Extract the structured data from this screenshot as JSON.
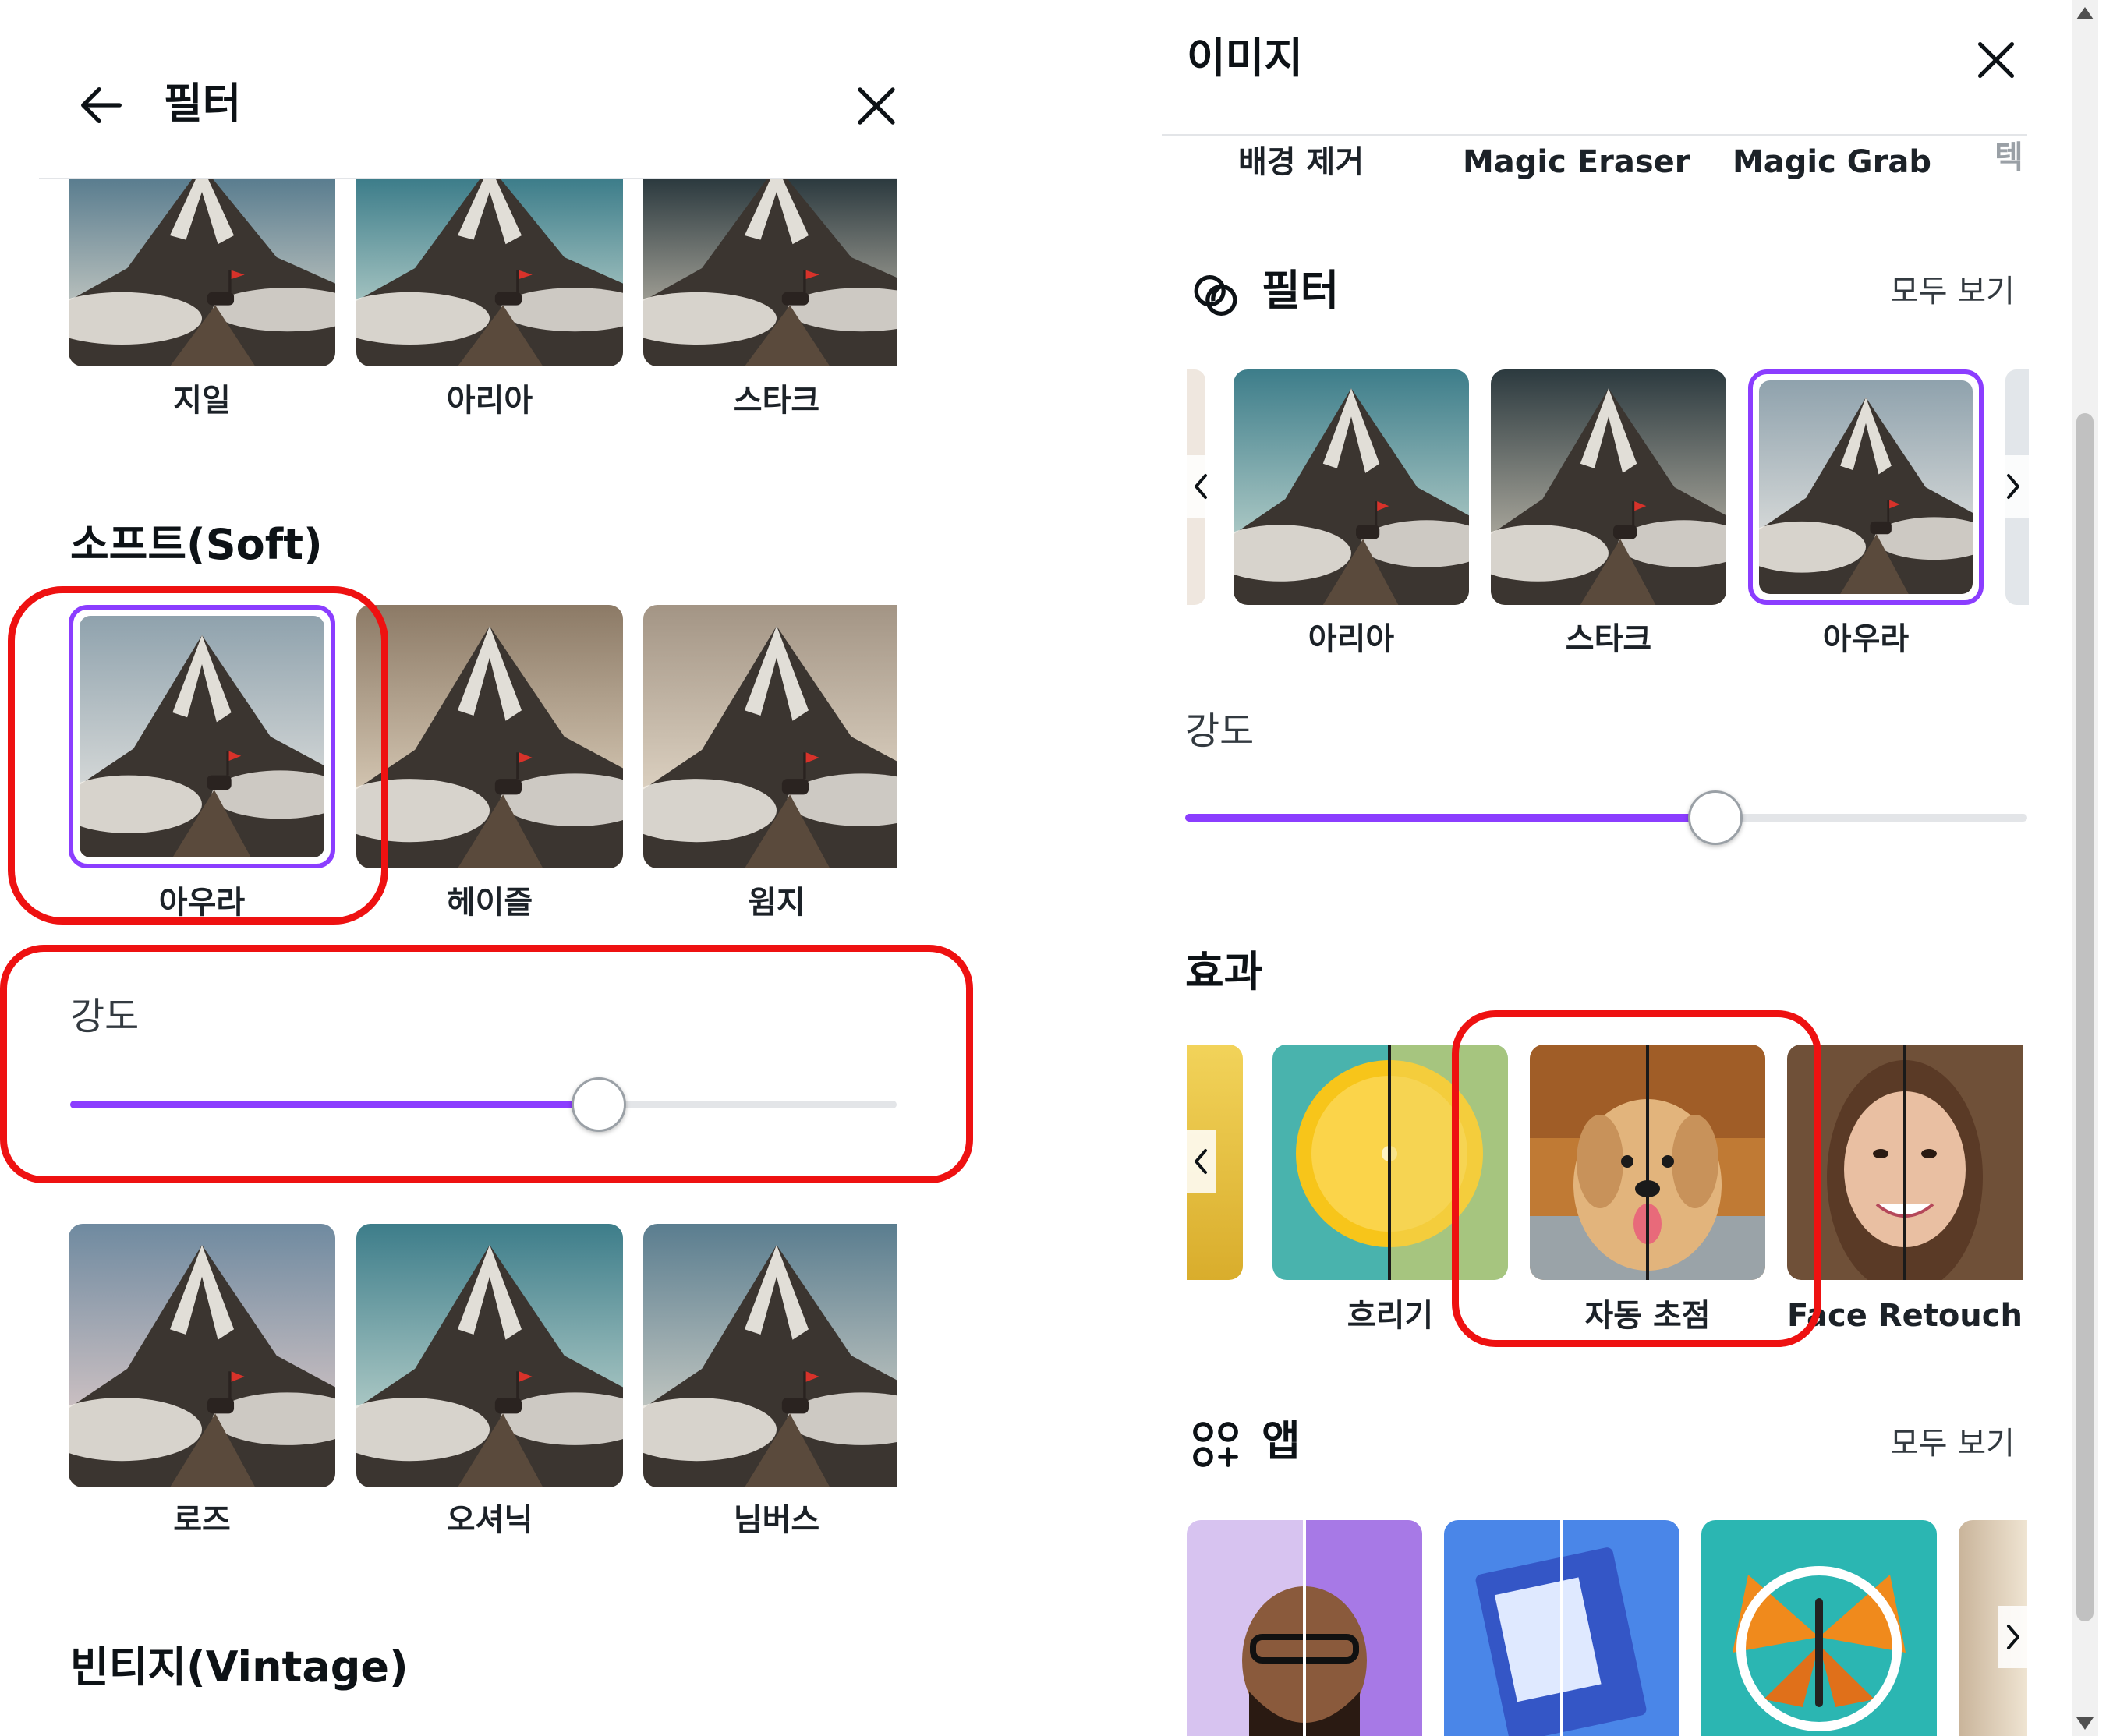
{
  "left_panel": {
    "title": "필터",
    "top_row": [
      "지일",
      "아리아",
      "스타크"
    ],
    "soft_section_title": "소프트(Soft)",
    "soft_row": [
      "아우라",
      "헤이즐",
      "윔지"
    ],
    "strength_label": "강도",
    "strength_value": 0.64,
    "bottom_row": [
      "로즈",
      "오셔닉",
      "님버스"
    ],
    "vintage_section_title": "빈티지(Vintage)"
  },
  "right_panel": {
    "title": "이미지",
    "tabs": [
      "배경 제거",
      "Magic Eraser",
      "Magic Grab",
      "텍"
    ],
    "filter_section": {
      "title": "필터",
      "see_all": "모두 보기",
      "items": [
        "아리아",
        "스타크",
        "아우라"
      ],
      "selected": "아우라"
    },
    "strength_label": "강도",
    "strength_value": 0.63,
    "effects_section": {
      "title": "효과",
      "items": [
        "흐리기",
        "자동 초점",
        "Face Retouch"
      ]
    },
    "apps_section": {
      "title": "앱",
      "see_all": "모두 보기"
    }
  },
  "colors": {
    "accent": "#8b3dff",
    "highlight": "#ee1111",
    "text": "#0d1216"
  },
  "icons": {
    "back": "arrow-left-icon",
    "close": "close-icon",
    "filter": "filter-circles-icon",
    "apps": "apps-grid-icon",
    "chevron_left": "chevron-left-icon",
    "chevron_right": "chevron-right-icon"
  }
}
